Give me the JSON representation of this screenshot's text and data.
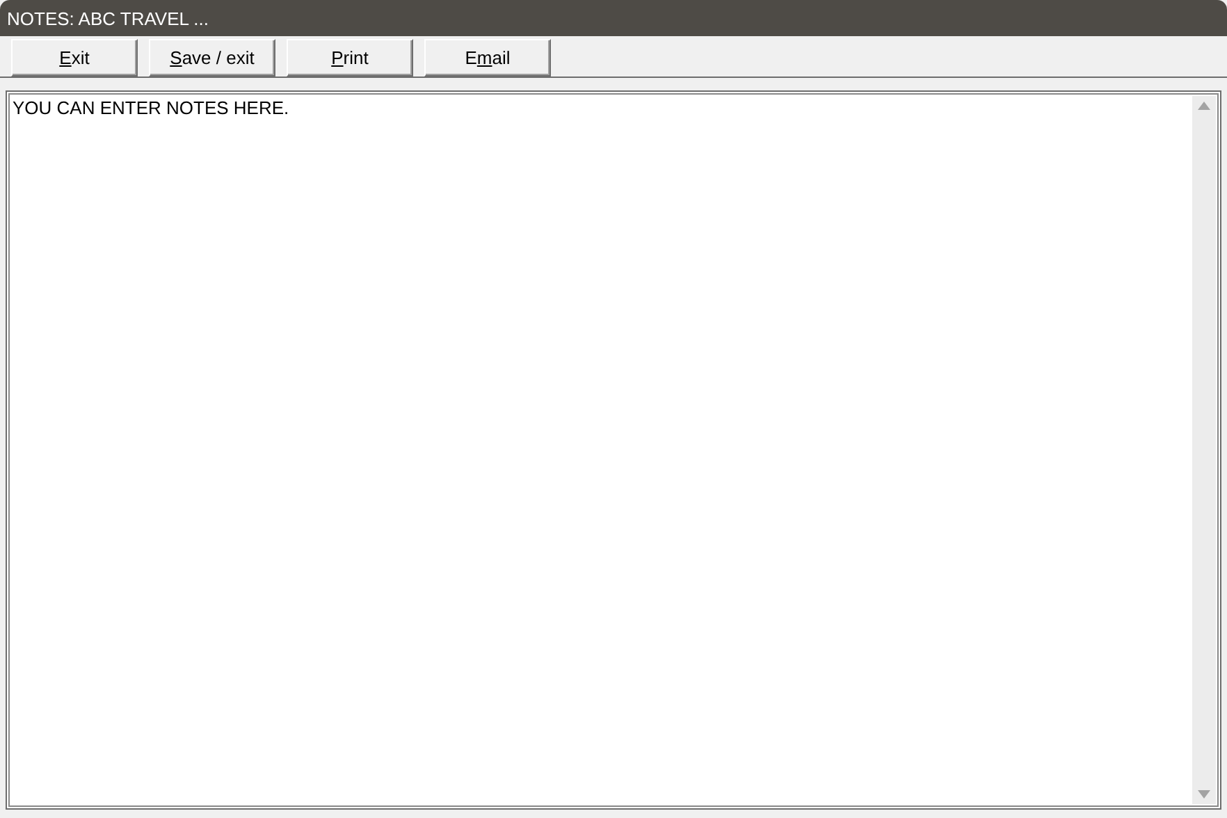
{
  "window": {
    "title": "NOTES: ABC TRAVEL ..."
  },
  "toolbar": [
    {
      "access_key": "E",
      "after": "xit"
    },
    {
      "access_key": "S",
      "after": "ave / exit"
    },
    {
      "access_key": "P",
      "after": "rint"
    },
    {
      "before": "E",
      "access_key": "m",
      "after": "ail"
    }
  ],
  "notes": {
    "value": "YOU CAN ENTER NOTES HERE."
  }
}
